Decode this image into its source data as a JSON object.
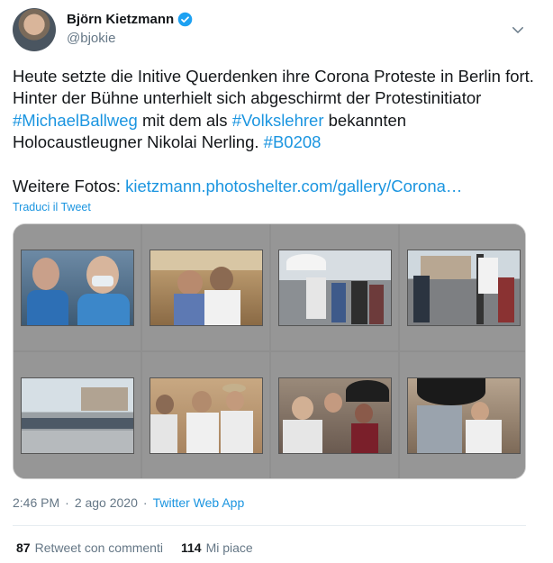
{
  "author": {
    "name": "Björn Kietzmann",
    "handle": "@bjokie",
    "avatar_icon": "profile-avatar",
    "verified_icon": "verified-badge-icon"
  },
  "tweet": {
    "line1": "Heute setzte die Initive Querdenken ihre Corona Proteste in Berlin fort. Hinter der Bühne unterhielt sich abgeschirmt der Protestinitiator ",
    "hashtag1": "#MichaelBallweg",
    "mid": " mit dem als ",
    "hashtag2": "#Volkslehrer",
    "line2": " bekannten Holocaustleugner Nikolai Nerling. ",
    "hashtag3": "#B0208",
    "more_label": "Weitere Fotos: ",
    "more_link": "kietzmann.photoshelter.com/gallery/Corona…"
  },
  "translate_label": "Traduci il Tweet",
  "media": {
    "thumbnails": [
      {
        "label": "photo-masks-closeup"
      },
      {
        "label": "photo-stage-speakers"
      },
      {
        "label": "photo-brandenburg-gate-crowd"
      },
      {
        "label": "photo-protest-flag"
      },
      {
        "label": "photo-rainy-square"
      },
      {
        "label": "photo-backstage-conversation"
      },
      {
        "label": "photo-umbrella-crowd"
      },
      {
        "label": "photo-umbrella-man"
      }
    ]
  },
  "meta": {
    "time": "2:46 PM",
    "sep": "·",
    "date": "2 ago 2020",
    "sep2": "·",
    "source": "Twitter Web App"
  },
  "stats": {
    "retweets_count": "87",
    "retweets_label": "Retweet con commenti",
    "likes_count": "114",
    "likes_label": "Mi piace"
  },
  "colors": {
    "link": "#1b95e0",
    "secondary": "#657786",
    "text": "#14171a"
  }
}
